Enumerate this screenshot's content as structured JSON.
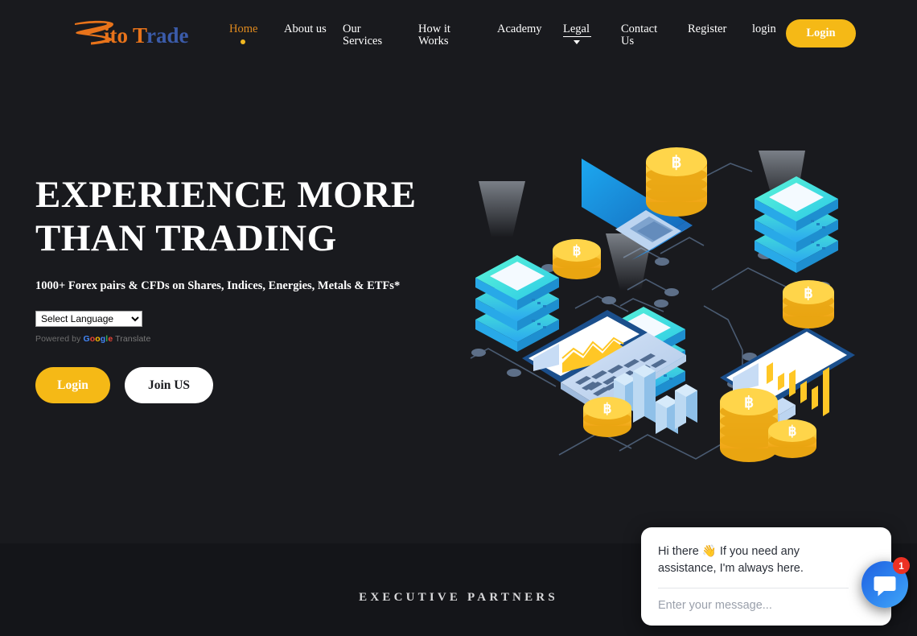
{
  "brand": {
    "name": "RitoTrade",
    "name_part_orange": "Rito",
    "name_part_t": "T",
    "name_part_blue": "rade",
    "accent_orange": "#E8731A",
    "accent_blue": "#3B5BA9",
    "accent_gold": "#F5B916"
  },
  "header": {
    "nav": [
      {
        "label": "Home",
        "active": true,
        "dropdown": false
      },
      {
        "label": "About us",
        "active": false,
        "dropdown": false
      },
      {
        "label": "Our Services",
        "active": false,
        "dropdown": false
      },
      {
        "label": "How it Works",
        "active": false,
        "dropdown": false
      },
      {
        "label": "Academy",
        "active": false,
        "dropdown": false
      },
      {
        "label": "Legal",
        "active": false,
        "dropdown": true
      },
      {
        "label": "Contact Us",
        "active": false,
        "dropdown": false
      },
      {
        "label": "Register",
        "active": false,
        "dropdown": false
      },
      {
        "label": "login",
        "active": false,
        "dropdown": false
      }
    ],
    "login_button": "Login"
  },
  "hero": {
    "title_line1": "EXPERIENCE MORE",
    "title_line2": "THAN TRADING",
    "subtitle": "1000+ Forex pairs & CFDs on Shares, Indices, Energies, Metals & ETFs*",
    "language_select": {
      "selected": "Select Language",
      "options": [
        "Select Language"
      ]
    },
    "translate_credit": {
      "prefix": "Powered by ",
      "brand": "Google",
      "suffix": " Translate"
    },
    "primary_button": "Login",
    "secondary_button": "Join US"
  },
  "partners": {
    "title": "EXECUTIVE PARTNERS"
  },
  "chat": {
    "greeting": "Hi there 👋 If you need any assistance, I'm always here.",
    "input_placeholder": "Enter your message...",
    "badge_count": "1",
    "fab_icon": "chat-bubble-icon",
    "fab_color": "#2f86f0",
    "badge_color": "#EC3124"
  },
  "illustration": {
    "alt": "isometric blockchain trading network with bitcoin coin stacks, servers, laptops and a monitor showing a bar chart",
    "colors": {
      "coin_gold": "#FFC726",
      "coin_gold_dark": "#E9A511",
      "server_teal": "#3FE8C8",
      "server_cyan": "#29B6F6",
      "device_navy": "#1B4F8C",
      "screen_light": "#C9DCF5"
    }
  }
}
